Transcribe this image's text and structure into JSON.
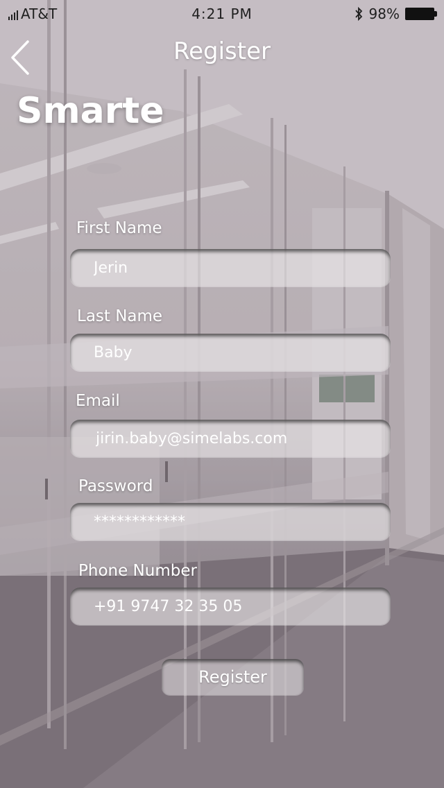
{
  "status_bar": {
    "carrier": "AT&T",
    "time": "4:21 PM",
    "battery": "98%",
    "icons": [
      "signal-icon",
      "bluetooth-icon",
      "battery-icon"
    ]
  },
  "nav": {
    "title": "Register",
    "back_icon": "chevron-left-icon"
  },
  "brand": {
    "title": "Smarte"
  },
  "form": {
    "first_name": {
      "label": "First Name",
      "placeholder": "Jerin"
    },
    "last_name": {
      "label": "Last Name",
      "placeholder": "Baby"
    },
    "email": {
      "label": "Email",
      "placeholder": "jirin.baby@simelabs.com"
    },
    "password": {
      "label": "Password",
      "placeholder": "************"
    },
    "phone": {
      "label": "Phone Number",
      "placeholder": "+91 9747 32 35 05"
    },
    "submit_label": "Register"
  },
  "colors": {
    "text": "#ffffff",
    "status_text": "#1f1f1f",
    "input_fill": "#ece8ea"
  }
}
